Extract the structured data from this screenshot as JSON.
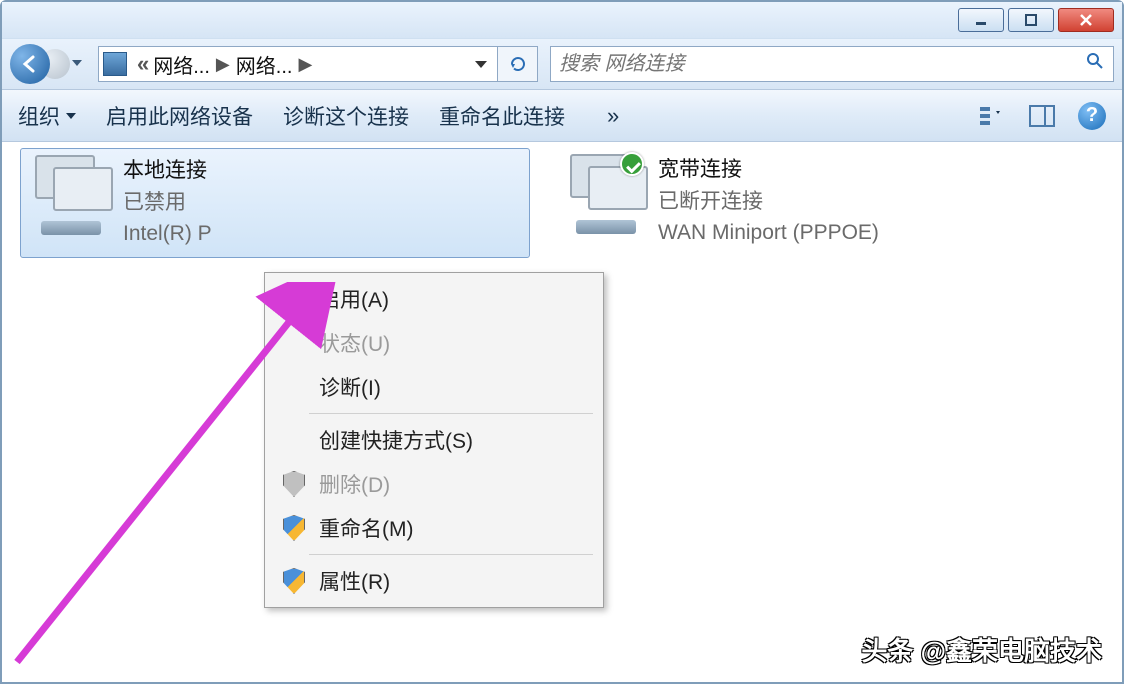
{
  "breadcrumb": {
    "crumb1": "网络...",
    "crumb2": "网络..."
  },
  "search": {
    "placeholder": "搜索 网络连接"
  },
  "toolbar": {
    "organize": "组织",
    "enable_device": "启用此网络设备",
    "diagnose": "诊断这个连接",
    "rename": "重命名此连接",
    "overflow": "»"
  },
  "connections": [
    {
      "title": "本地连接",
      "status": "已禁用",
      "device": "Intel(R) P"
    },
    {
      "title": "宽带连接",
      "status": "已断开连接",
      "device": "WAN Miniport (PPPOE)"
    }
  ],
  "context_menu": {
    "enable": "启用(A)",
    "status": "状态(U)",
    "diagnose": "诊断(I)",
    "shortcut": "创建快捷方式(S)",
    "delete": "删除(D)",
    "rename": "重命名(M)",
    "properties": "属性(R)"
  },
  "watermark": "头条 @鑫荣电脑技术"
}
